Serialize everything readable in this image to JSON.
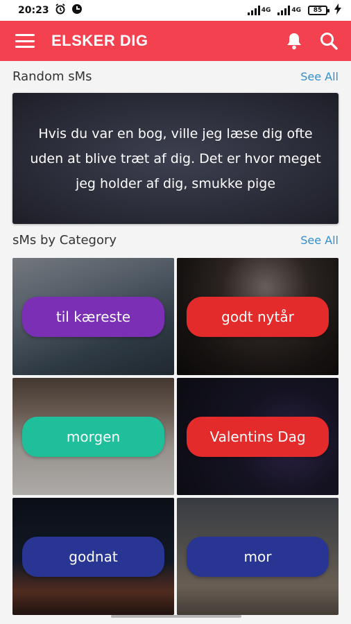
{
  "status_bar": {
    "time": "20:23",
    "network_1": "4G",
    "network_2": "4G",
    "battery": "85"
  },
  "app_bar": {
    "title": "ELSKER DIG",
    "menu_icon": "hamburger-menu-icon",
    "notification_icon": "bell-icon",
    "search_icon": "search-icon"
  },
  "random_section": {
    "title": "Random sMs",
    "see_all": "See All",
    "message": "Hvis du var en bog, ville jeg læse dig ofte uden at blive træt af dig. Det er hvor meget jeg holder af dig, smukke pige"
  },
  "category_section": {
    "title": "sMs by Category",
    "see_all": "See All",
    "categories": [
      {
        "label": "til kæreste",
        "color": "#7b2fb5"
      },
      {
        "label": "godt nytår",
        "color": "#e32b2b"
      },
      {
        "label": "morgen",
        "color": "#1fbf9c"
      },
      {
        "label": "Valentins Dag",
        "color": "#e32b2b"
      },
      {
        "label": "godnat",
        "color": "#283593"
      },
      {
        "label": "mor",
        "color": "#283593"
      }
    ]
  },
  "colors": {
    "accent": "#f34150",
    "link": "#2f8fd0"
  }
}
